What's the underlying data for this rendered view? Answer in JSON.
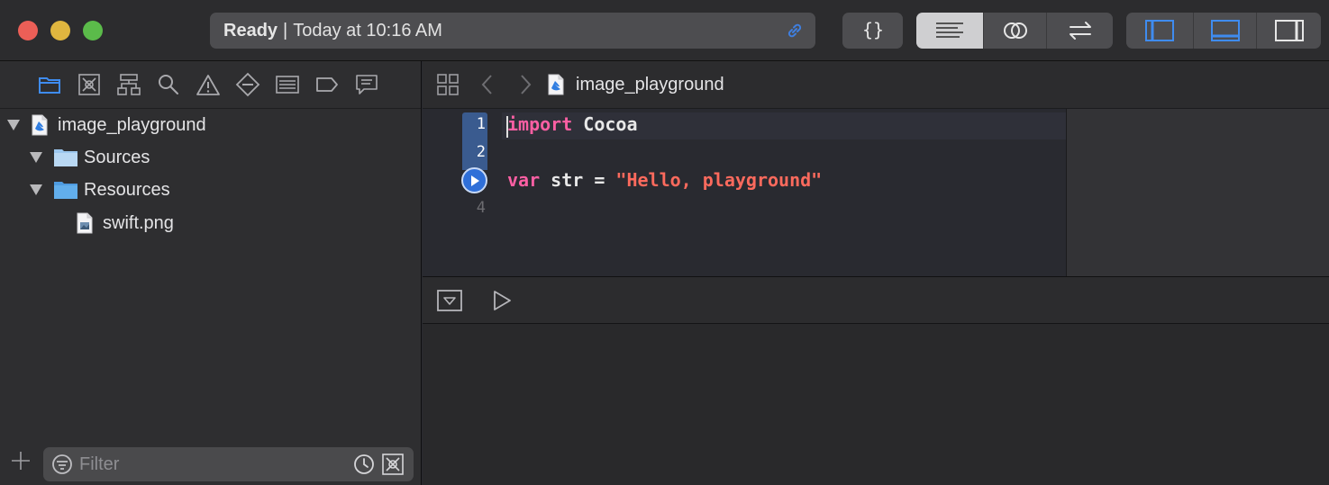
{
  "activity": {
    "status": "Ready",
    "separator": "|",
    "time": "Today at 10:16 AM"
  },
  "toolbar": {
    "library_icon": "curly-braces-icon",
    "editor_modes": [
      "standard-editor-icon",
      "assistant-editor-icon",
      "version-editor-icon"
    ],
    "active_editor_mode": "standard-editor-icon",
    "panels": [
      "navigator-panel-icon",
      "debug-panel-icon",
      "inspector-panel-icon"
    ]
  },
  "navigator": {
    "tabs": [
      "folder-icon",
      "source-control-icon",
      "hierarchy-icon",
      "search-icon",
      "warning-icon",
      "test-icon",
      "debug-icon",
      "breakpoint-icon",
      "report-icon"
    ],
    "tree": [
      {
        "label": "image_playground",
        "type": "playground",
        "expanded": true
      },
      {
        "label": "Sources",
        "type": "folder",
        "expanded": true
      },
      {
        "label": "Resources",
        "type": "folder",
        "expanded": true
      },
      {
        "label": "swift.png",
        "type": "image-file"
      }
    ],
    "filter_placeholder": "Filter"
  },
  "jumpbar": {
    "file": "image_playground"
  },
  "editor": {
    "line_numbers": [
      "1",
      "2",
      "4"
    ],
    "code": {
      "line1_kw": "import",
      "line1_rest": " Cocoa",
      "line3_kw": "var",
      "line3_mid": " str = ",
      "line3_str": "\"Hello, playground\""
    }
  },
  "colors": {
    "keyword": "#fc5fa3",
    "string": "#fc6a5d",
    "accent": "#2f6fd8"
  }
}
